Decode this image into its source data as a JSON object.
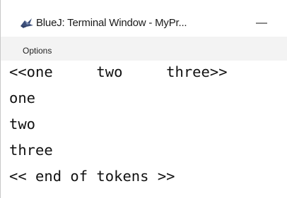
{
  "window": {
    "title": "BlueJ: Terminal Window - MyPr...",
    "minimize_symbol": "—",
    "icon": "bluej-bird-icon"
  },
  "menu": {
    "items": [
      {
        "label": "Options"
      }
    ]
  },
  "terminal": {
    "lines": [
      "<<one     two     three>>",
      "one",
      "two",
      "three",
      "<< end of tokens >>"
    ]
  }
}
